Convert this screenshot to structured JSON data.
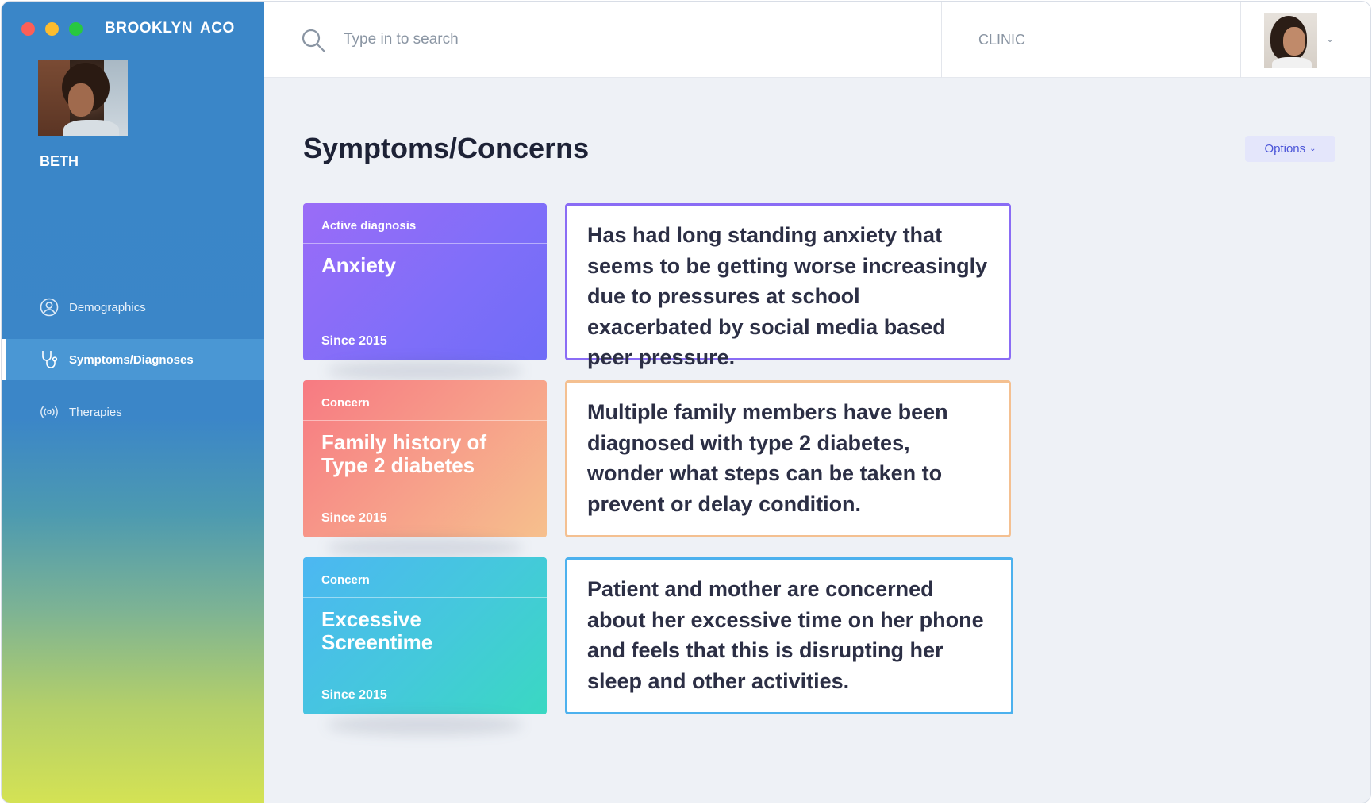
{
  "app": {
    "brand": "BROOKLYN  ACO"
  },
  "patient": {
    "name": "BETH"
  },
  "sidebar": {
    "items": [
      {
        "label": "Demographics",
        "icon": "user-circle-icon",
        "active": false
      },
      {
        "label": "Symptoms/Diagnoses",
        "icon": "stethoscope-icon",
        "active": true
      },
      {
        "label": "Therapies",
        "icon": "broadcast-icon",
        "active": false
      }
    ]
  },
  "topbar": {
    "search_placeholder": "Type in to search",
    "clinic_label": "CLINIC"
  },
  "main": {
    "title": "Symptoms/Concerns",
    "options_label": "Options",
    "cards": [
      {
        "tag": "Active diagnosis",
        "title": "Anxiety",
        "since": "Since 2015",
        "note": "Has had long standing anxiety that seems to be getting worse increasingly due to pressures at school exacerbated by social media based peer pressure.",
        "color": "#8a6cf5"
      },
      {
        "tag": "Concern",
        "title": "Family history of Type 2 diabetes",
        "since": "Since 2015",
        "note": "Multiple family members have been diagnosed with type 2 diabetes, wonder what steps can be taken to prevent or delay condition.",
        "color": "#f4c091"
      },
      {
        "tag": "Concern",
        "title": "Excessive Screentime",
        "since": "Since 2015",
        "note": "Patient and mother are concerned about her excessive time on her phone and feels that this is disrupting her sleep and other activities.",
        "color": "#4cb1ee"
      }
    ]
  },
  "colors": {
    "sidebar_top": "#3a86c8",
    "sidebar_bottom": "#d4e254",
    "active_nav": "#4a97d4",
    "options_text": "#4b55d8"
  }
}
